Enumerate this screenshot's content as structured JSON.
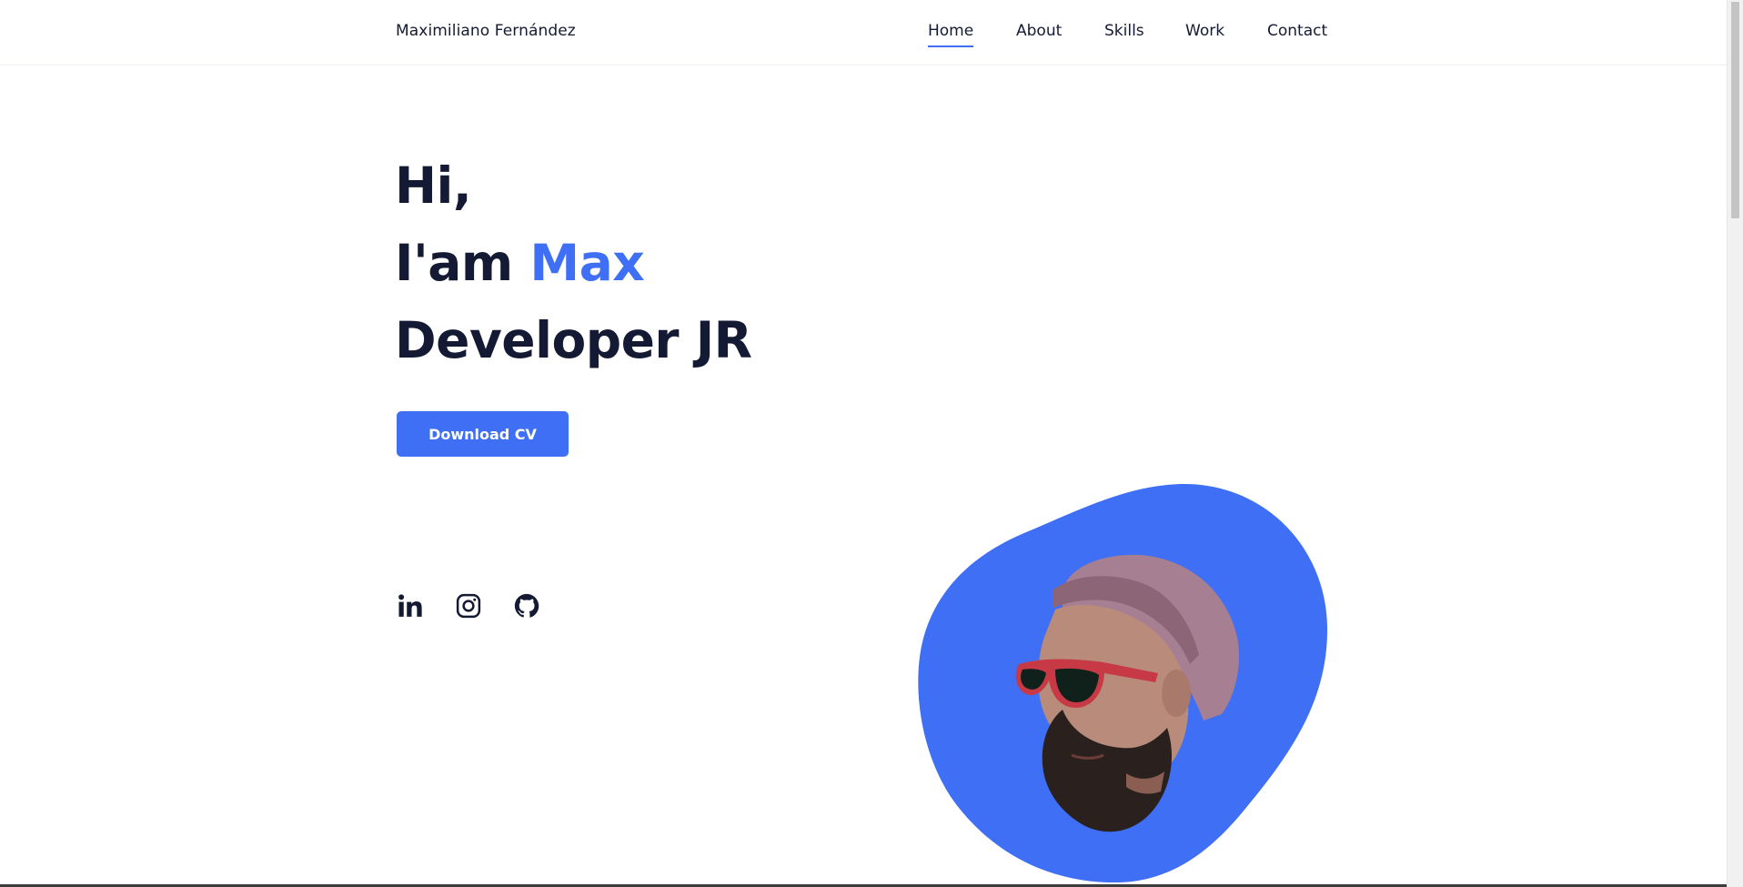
{
  "header": {
    "logo": "Maximiliano Fernández",
    "nav": [
      {
        "label": "Home",
        "active": true
      },
      {
        "label": "About",
        "active": false
      },
      {
        "label": "Skills",
        "active": false
      },
      {
        "label": "Work",
        "active": false
      },
      {
        "label": "Contact",
        "active": false
      }
    ]
  },
  "hero": {
    "line1": "Hi,",
    "line2_prefix": "I'am ",
    "line2_accent": "Max",
    "line3": "Developer JR",
    "button_label": "Download CV"
  },
  "socials": [
    {
      "name": "linkedin-icon"
    },
    {
      "name": "instagram-icon"
    },
    {
      "name": "github-icon"
    }
  ],
  "portrait": {
    "name": "profile-photo"
  },
  "colors": {
    "accent": "#3e6ff4",
    "text": "#141a33",
    "background": "#ffffff"
  }
}
